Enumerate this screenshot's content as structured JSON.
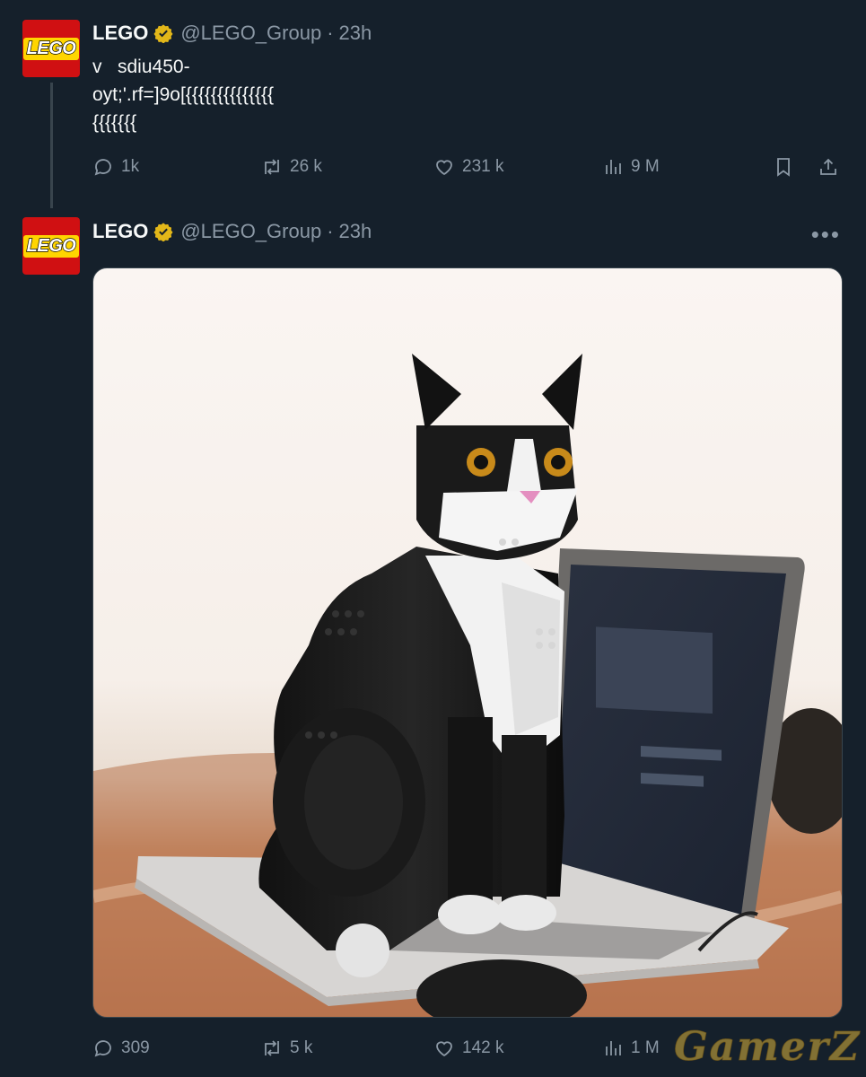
{
  "tweets": [
    {
      "name": "LEGO",
      "handle": "@LEGO_Group",
      "separator": "·",
      "time": "23h",
      "avatar_text": "LEGO",
      "text": "v   sdiu450-\noyt;'.rf=]9o[{{{{{{{{{{{{{{\n{{{{{{{",
      "stats": {
        "replies": "1k",
        "retweets": "26 k",
        "likes": "231 k",
        "views": "9 M"
      }
    },
    {
      "name": "LEGO",
      "handle": "@LEGO_Group",
      "separator": "·",
      "time": "23h",
      "avatar_text": "LEGO",
      "more": "•••",
      "stats": {
        "replies": "309",
        "retweets": "5 k",
        "likes": "142 k",
        "views": "1 M"
      }
    }
  ],
  "watermark": "GamerZ",
  "colors": {
    "background": "#15202b",
    "verified": "#e2b719",
    "muted": "#8b98a5",
    "brand": "#d01012"
  },
  "icons": [
    "reply-icon",
    "retweet-icon",
    "like-icon",
    "views-icon",
    "bookmark-icon",
    "share-icon",
    "verified-badge-icon",
    "more-icon"
  ]
}
